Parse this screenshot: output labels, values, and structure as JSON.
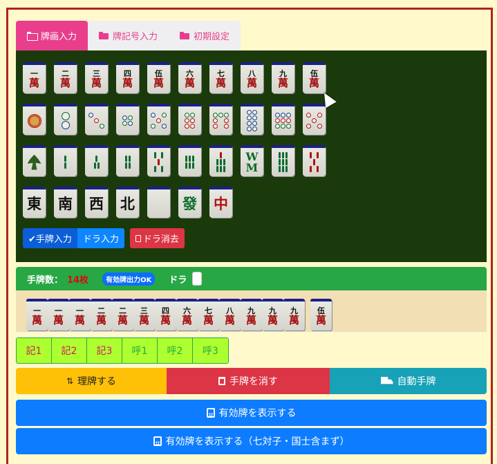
{
  "tabs": [
    {
      "label": "牌画入力",
      "active": true
    },
    {
      "label": "牌記号入力",
      "active": false
    },
    {
      "label": "初期設定",
      "active": false
    }
  ],
  "board": {
    "man_row": [
      {
        "num": "一",
        "suit": "萬"
      },
      {
        "num": "二",
        "suit": "萬"
      },
      {
        "num": "三",
        "suit": "萬"
      },
      {
        "num": "四",
        "suit": "萬"
      },
      {
        "num": "伍",
        "suit": "萬"
      },
      {
        "num": "六",
        "suit": "萬"
      },
      {
        "num": "七",
        "suit": "萬"
      },
      {
        "num": "八",
        "suit": "萬"
      },
      {
        "num": "九",
        "suit": "萬"
      },
      {
        "num": "伍",
        "suit": "萬"
      }
    ],
    "honor_row": [
      {
        "label": "東",
        "color": "black"
      },
      {
        "label": "南",
        "color": "black"
      },
      {
        "label": "西",
        "color": "black"
      },
      {
        "label": "北",
        "color": "black"
      },
      {
        "label": "",
        "color": "white"
      },
      {
        "label": "發",
        "color": "green"
      },
      {
        "label": "中",
        "color": "red"
      }
    ],
    "buttons": {
      "hand_input": "✔手牌入力",
      "dora_input": "ドラ入力",
      "dora_clear": "ドラ消去"
    }
  },
  "hand": {
    "count_label": "手牌数：",
    "count_value": "14枚",
    "badge": "有効牌出力OK",
    "dora_label": "ドラ",
    "tiles": [
      {
        "num": "一",
        "suit": "萬"
      },
      {
        "num": "一",
        "suit": "萬"
      },
      {
        "num": "一",
        "suit": "萬"
      },
      {
        "num": "二",
        "suit": "萬"
      },
      {
        "num": "二",
        "suit": "萬"
      },
      {
        "num": "三",
        "suit": "萬"
      },
      {
        "num": "四",
        "suit": "萬"
      },
      {
        "num": "六",
        "suit": "萬"
      },
      {
        "num": "七",
        "suit": "萬"
      },
      {
        "num": "八",
        "suit": "萬"
      },
      {
        "num": "九",
        "suit": "萬"
      },
      {
        "num": "九",
        "suit": "萬"
      },
      {
        "num": "九",
        "suit": "萬"
      }
    ],
    "drawn": {
      "num": "伍",
      "suit": "萬"
    }
  },
  "memo": [
    "記1",
    "記2",
    "記3",
    "呼1",
    "呼2",
    "呼3"
  ],
  "actions": {
    "sort": "理牌する",
    "clear": "手牌を消す",
    "auto": "自動手牌"
  },
  "show_effective": "有効牌を表示する",
  "show_effective_alt": "有効牌を表示する（七対子・国士含まず）",
  "colors": {
    "board_bg": "#1a3a0c",
    "pink": "#e83e8c",
    "green": "#28a745",
    "blue": "#0d7cff",
    "red": "#dc3545",
    "yellow": "#ffc107",
    "teal": "#17a2b8"
  }
}
